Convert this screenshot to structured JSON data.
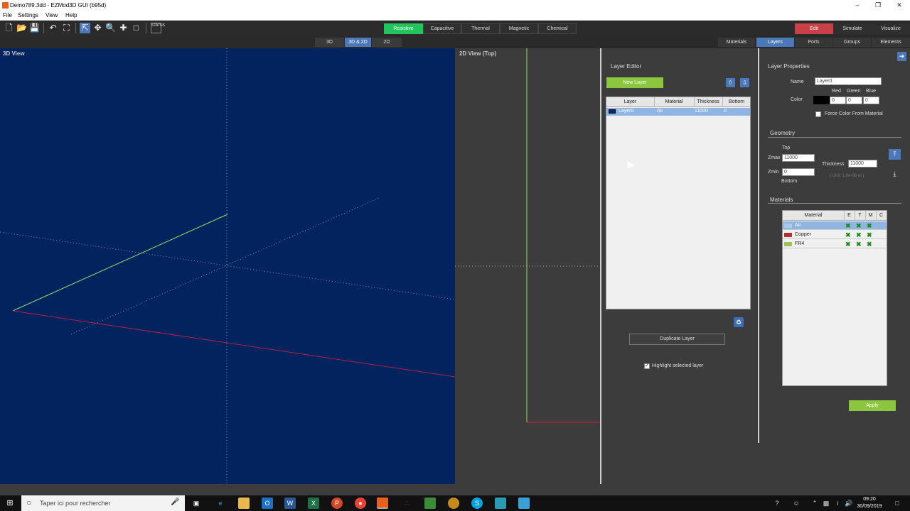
{
  "window": {
    "title": "Demo789.3dd - EZMod3D GUI (b95d)",
    "min_icon": "minimize-icon",
    "max_icon": "restore-icon",
    "close_icon": "close-icon"
  },
  "menu": [
    "File",
    "Settings",
    "View",
    "Help"
  ],
  "toolbar": {
    "icons": [
      "new-file-icon",
      "open-folder-icon",
      "save-icon",
      "undo-icon",
      "fit-view-icon",
      "select-icon",
      "pan-icon",
      "zoom-icon",
      "add-point-icon",
      "select-box-icon",
      "status-icon"
    ],
    "status_label": "STATUS",
    "physics": [
      "Resistive",
      "Capacitive",
      "Thermal",
      "Magnetic",
      "Chemical"
    ],
    "physics_active": "Resistive",
    "modes": [
      "Edit",
      "Simulate",
      "Visualize"
    ],
    "mode_active": "Edit"
  },
  "view_modes": [
    "3D",
    "3D & 2D",
    "2D"
  ],
  "view_mode_active": "3D & 2D",
  "tabs": [
    "Materials",
    "Layers",
    "Ports",
    "Groups",
    "Elements"
  ],
  "tab_active": "Layers",
  "views": {
    "left_title": "3D View",
    "right_title": "2D View (Top)"
  },
  "layer_editor": {
    "title": "Layer Editor",
    "new_layer": "New Layer",
    "columns": [
      "Layer",
      "Material",
      "Thickness",
      "Bottom"
    ],
    "rows": [
      {
        "name": "Layer0",
        "material": "Air",
        "thickness": "11000",
        "bottom": "0"
      }
    ],
    "duplicate": "Duplicate Layer",
    "highlight": "Highlight selected layer"
  },
  "layer_props": {
    "title": "Layer Properties",
    "name_label": "Name",
    "name_value": "Layer0",
    "color_label": "Color",
    "red_label": "Red",
    "green_label": "Green",
    "blue_label": "Blue",
    "red": "0",
    "green": "0",
    "blue": "0",
    "force_color": "Force Color From Material",
    "geometry_title": "Geometry",
    "top_label": "Top",
    "zmax_label": "Zmax",
    "zmax": "11000",
    "zmin_label": "Zmin",
    "zmin": "0",
    "bottom_label": "Bottom",
    "thickness_label": "Thickness",
    "thickness": "11000",
    "unit": "( Unit: 1.0e-06 m )",
    "materials_title": "Materials",
    "mat_columns": [
      "Material",
      "E",
      "T",
      "M",
      "C"
    ],
    "materials": [
      {
        "name": "Air",
        "color": "#a9c8ec"
      },
      {
        "name": "Copper",
        "color": "#b03030"
      },
      {
        "name": "FR4",
        "color": "#9cc05a"
      }
    ],
    "apply": "Apply"
  },
  "taskbar": {
    "search_placeholder": "Taper ici pour rechercher",
    "time": "09:20",
    "date": "30/09/2019"
  },
  "colors": {
    "view3d_bg": "#03235e",
    "accent": "#4a78b8",
    "active_physics": "#21c55d",
    "edit": "#c94048",
    "green_btn": "#8cc63f"
  }
}
